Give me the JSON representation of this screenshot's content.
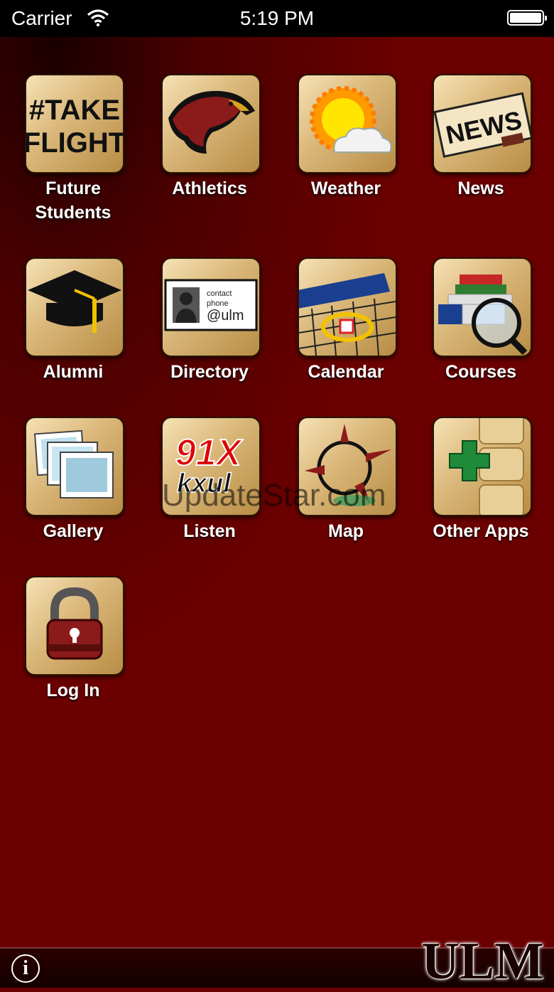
{
  "status_bar": {
    "carrier": "Carrier",
    "time": "5:19 PM"
  },
  "tiles": [
    {
      "label": "Future Students",
      "icon": "take-flight-icon"
    },
    {
      "label": "Athletics",
      "icon": "warhawk-icon"
    },
    {
      "label": "Weather",
      "icon": "sun-cloud-icon"
    },
    {
      "label": "News",
      "icon": "newspaper-icon"
    },
    {
      "label": "Alumni",
      "icon": "graduation-cap-icon"
    },
    {
      "label": "Directory",
      "icon": "contact-card-icon"
    },
    {
      "label": "Calendar",
      "icon": "calendar-icon"
    },
    {
      "label": "Courses",
      "icon": "books-magnifier-icon"
    },
    {
      "label": "Gallery",
      "icon": "photos-icon"
    },
    {
      "label": "Listen",
      "icon": "radio-icon"
    },
    {
      "label": "Map",
      "icon": "compass-icon"
    },
    {
      "label": "Other Apps",
      "icon": "plus-icon"
    },
    {
      "label": "Log In",
      "icon": "lock-icon"
    }
  ],
  "icon_text": {
    "take_flight_line1": "#TAKE",
    "take_flight_line2": "FLIGHT",
    "news_word": "NEWS",
    "directory_contact": "contact",
    "directory_phone": "phone",
    "directory_ulm": "@ulm",
    "radio_freq": "91X",
    "radio_call": "kxul"
  },
  "watermark": "UpdateStar.com",
  "footer": {
    "info_symbol": "i",
    "logo_text": "ULM"
  },
  "colors": {
    "background": "#6b0000",
    "tile_gold": "#d9b678",
    "brand_maroon": "#8b1a1a"
  }
}
